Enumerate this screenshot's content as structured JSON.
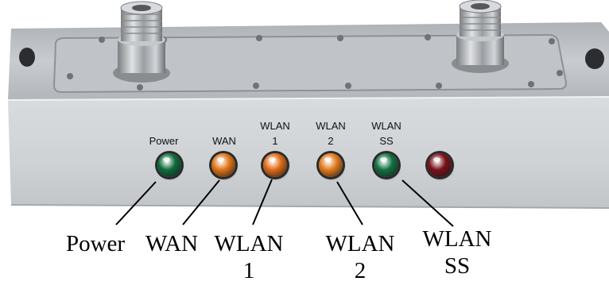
{
  "panel_labels": {
    "power": "Power",
    "wan": "WAN",
    "wlan1_top": "WLAN",
    "wlan1_bottom": "1",
    "wlan2_top": "WLAN",
    "wlan2_bottom": "2",
    "wlanss_top": "WLAN",
    "wlanss_bottom": "SS"
  },
  "callouts": {
    "power": "Power",
    "wan": "WAN",
    "wlan1_top": "WLAN",
    "wlan1_bottom": "1",
    "wlan2_top": "WLAN",
    "wlan2_bottom": "2",
    "wlanss_top": "WLAN",
    "wlanss_bottom": "SS"
  },
  "led_colors": {
    "power": "#0f6b3a",
    "wan": "#e07418",
    "wlan1": "#e06a16",
    "wlan2": "#e27a1c",
    "wlanss": "#127040",
    "unlabeled": "#7a1018"
  },
  "colors": {
    "chassis": "#c9ccd0",
    "front_panel": "#d3d6d9",
    "connector": "#b8bcc0"
  }
}
